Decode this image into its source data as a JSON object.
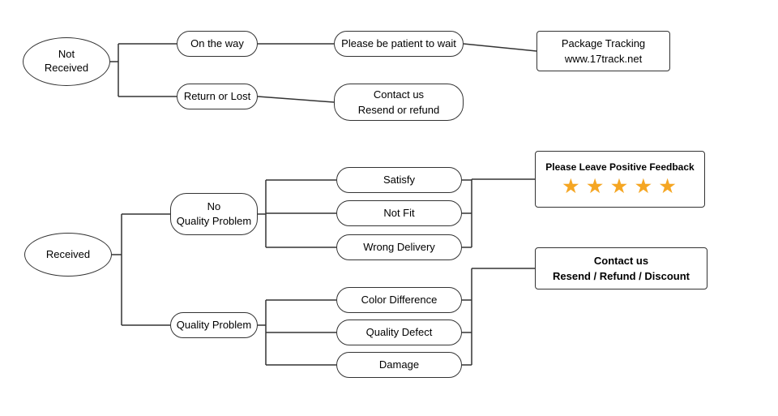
{
  "nodes": {
    "not_received": {
      "label": "Not\nReceived"
    },
    "on_the_way": {
      "label": "On the way"
    },
    "return_or_lost": {
      "label": "Return or Lost"
    },
    "be_patient": {
      "label": "Please be patient to wait"
    },
    "package_tracking": {
      "label": "Package Tracking\nwww.17track.net"
    },
    "contact_resend_refund": {
      "label": "Contact us\nResend or refund"
    },
    "received": {
      "label": "Received"
    },
    "no_quality_problem": {
      "label": "No\nQuality Problem"
    },
    "quality_problem": {
      "label": "Quality Problem"
    },
    "satisfy": {
      "label": "Satisfy"
    },
    "not_fit": {
      "label": "Not Fit"
    },
    "wrong_delivery": {
      "label": "Wrong Delivery"
    },
    "color_difference": {
      "label": "Color Difference"
    },
    "quality_defect": {
      "label": "Quality Defect"
    },
    "damage": {
      "label": "Damage"
    },
    "please_leave_feedback": {
      "label": "Please Leave Positive Feedback"
    },
    "stars": {
      "value": "★ ★ ★ ★ ★"
    },
    "contact_resend_refund_discount": {
      "label": "Contact us\nResend / Refund / Discount"
    }
  }
}
